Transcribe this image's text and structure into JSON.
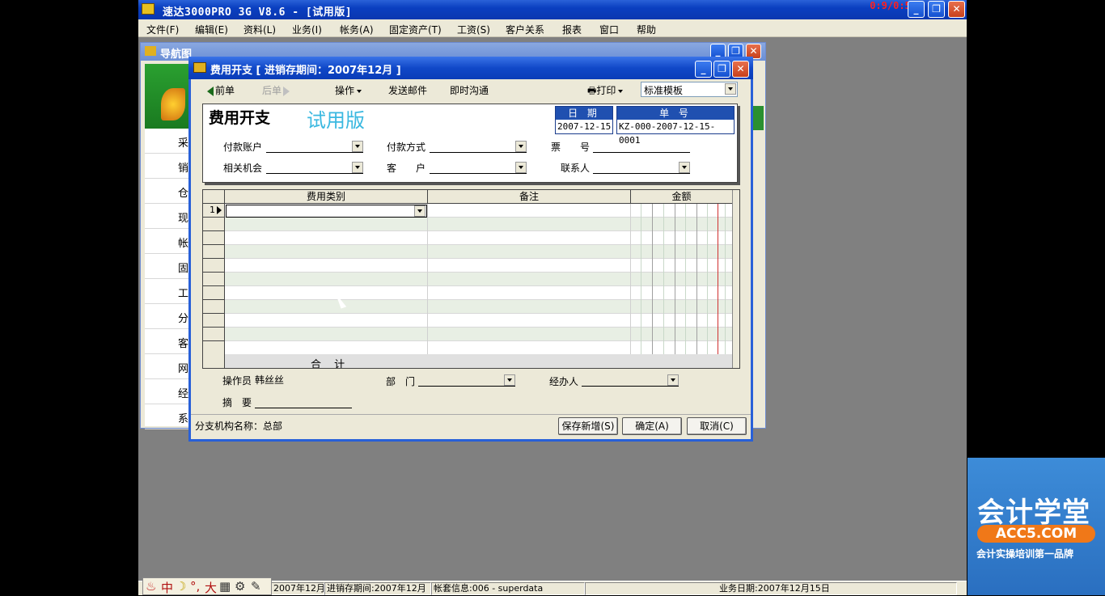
{
  "app": {
    "title": "速达3000PRO 3G V8.6 - [试用版]",
    "timer": "0:9/0:59",
    "controls": {
      "minimize": "_",
      "restore": "❐",
      "close": "✕"
    }
  },
  "menu": [
    "文件(F)",
    "编辑(E)",
    "资料(L)",
    "业务(I)",
    "帐务(A)",
    "固定资产(T)",
    "工资(S)",
    "客户关系",
    "报表",
    "窗口",
    "帮助"
  ],
  "navigator": {
    "title": "导航图",
    "items": [
      "采",
      "销",
      "仓",
      "现",
      "帐",
      "固",
      "工",
      "分",
      "客",
      "网",
      "经",
      "系"
    ]
  },
  "dialog": {
    "title": "费用开支 [ 进销存期间：2007年12月 ]",
    "toolbar": {
      "prev": "前单",
      "next": "后单",
      "operate": "操作",
      "email": "发送邮件",
      "chat": "即时沟通",
      "print": "打印",
      "template": "标准模板"
    },
    "form": {
      "title": "费用开支",
      "trial": "试用版",
      "date_label": "日 期",
      "date_value": "2007-12-15",
      "no_label": "单 号",
      "no_value": "KZ-000-2007-12-15-0001",
      "pay_account": "付款账户",
      "pay_method": "付款方式",
      "ticket_no": "票　　号",
      "opportunity": "相关机会",
      "customer": "客　　户",
      "contact": "联系人"
    },
    "grid": {
      "columns": [
        "费用类别",
        "备注",
        "金额"
      ],
      "first_row": "1",
      "total": "合 计"
    },
    "footer": {
      "operator_label": "操作员",
      "operator_value": "韩丝丝",
      "dept_label": "部　门",
      "handler_label": "经办人",
      "summary_label": "摘　要",
      "branch": "分支机构名称：总部",
      "save_new": "保存新增(S)",
      "ok": "确定(A)",
      "cancel": "取消(C)"
    }
  },
  "status": {
    "ime": [
      "中",
      "☽",
      "°,",
      "大",
      "▦",
      "⚙",
      "✎"
    ],
    "period": "2007年12月",
    "inv_period": "进销存期间:2007年12月",
    "account": "帐套信息:006 - superdata",
    "biz_date": "业务日期:2007年12月15日"
  },
  "ad": {
    "line1": "会计学堂",
    "line2": "ACC5.COM",
    "line3": "会计实操培训第一品牌"
  }
}
